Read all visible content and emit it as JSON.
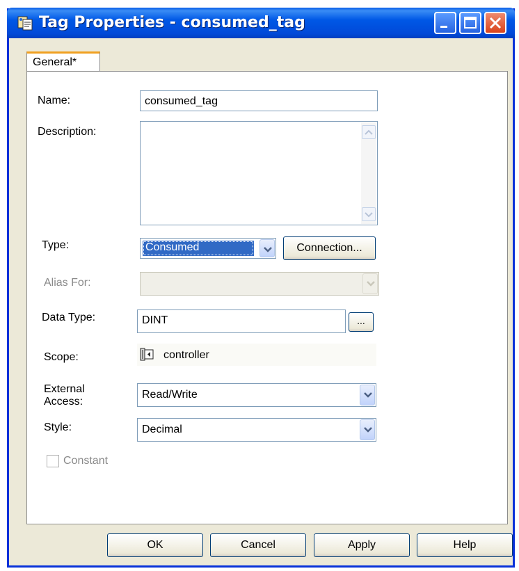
{
  "window": {
    "title": "Tag Properties - consumed_tag",
    "icons": {
      "app": "tag-properties-app-icon",
      "minimize": "minimize-icon",
      "maximize": "maximize-icon",
      "close": "close-icon"
    }
  },
  "tabs": [
    {
      "label": "General*",
      "active": true
    }
  ],
  "form": {
    "name_label": "Name:",
    "name_value": "consumed_tag",
    "description_label": "Description:",
    "description_value": "",
    "type_label": "Type:",
    "type_value": "Consumed",
    "connection_button": "Connection...",
    "alias_label": "Alias For:",
    "alias_value": "",
    "data_type_label": "Data Type:",
    "data_type_value": "DINT",
    "data_type_browse": "...",
    "scope_label": "Scope:",
    "scope_value": "controller",
    "scope_icon": "controller-icon",
    "external_access_label_1": "External",
    "external_access_label_2": "Access:",
    "external_access_value": "Read/Write",
    "style_label": "Style:",
    "style_value": "Decimal",
    "constant_label": "Constant",
    "constant_checked": false
  },
  "buttons": {
    "ok": "OK",
    "cancel": "Cancel",
    "apply": "Apply",
    "help": "Help"
  },
  "colors": {
    "titlebar": "#0058e6",
    "selection": "#316ac5",
    "dialog_bg": "#ece9d8",
    "tab_accent": "#f0a020"
  }
}
